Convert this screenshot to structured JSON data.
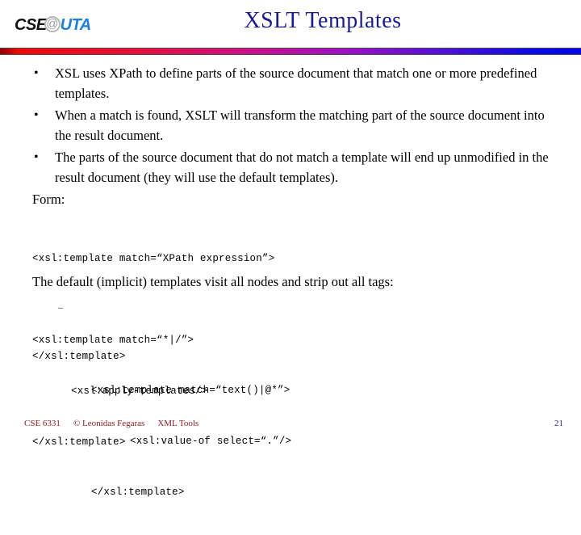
{
  "header": {
    "logo": {
      "part1": "CSE",
      "at_symbol": "@",
      "part2": "UTA"
    },
    "title": "XSLT Templates",
    "title_color": "#1b1b8f",
    "rule_gradient_from": "#f00808",
    "rule_gradient_to": "#0404f0"
  },
  "body": {
    "bullet_marker": "•",
    "bullets": [
      "XSL uses XPath to define parts of the source document that match one or more predefined templates.",
      "When a match is found, XSLT will transform the matching part of the source document into the result document.",
      "The parts of the source document that do not match a template will end up unmodified in the result document (they will use the  default templates)."
    ],
    "form_label": "Form:",
    "form_code": {
      "line1": "<xsl:template match=“XPath expression”>",
      "line2": "…",
      "line3": "</xsl:template>"
    },
    "default_note": "The default (implicit) templates visit all nodes and strip out all tags:",
    "default_code_a": {
      "line1": "<xsl:template match=“*|/”>",
      "line2": "<xsl:apply-templates/>",
      "line3": "</xsl:template>"
    },
    "default_code_b": {
      "line1": "<xsl:template match=“text()|@*”>",
      "line2": "<xsl:value-of select=“.”/>",
      "line3": "</xsl:template>"
    }
  },
  "footer": {
    "course": "CSE 6331",
    "copyright": "© Leonidas Fegaras",
    "topic": "XML Tools",
    "page_number": "21",
    "text_color": "#8c1b20",
    "page_number_color": "#24247a"
  }
}
